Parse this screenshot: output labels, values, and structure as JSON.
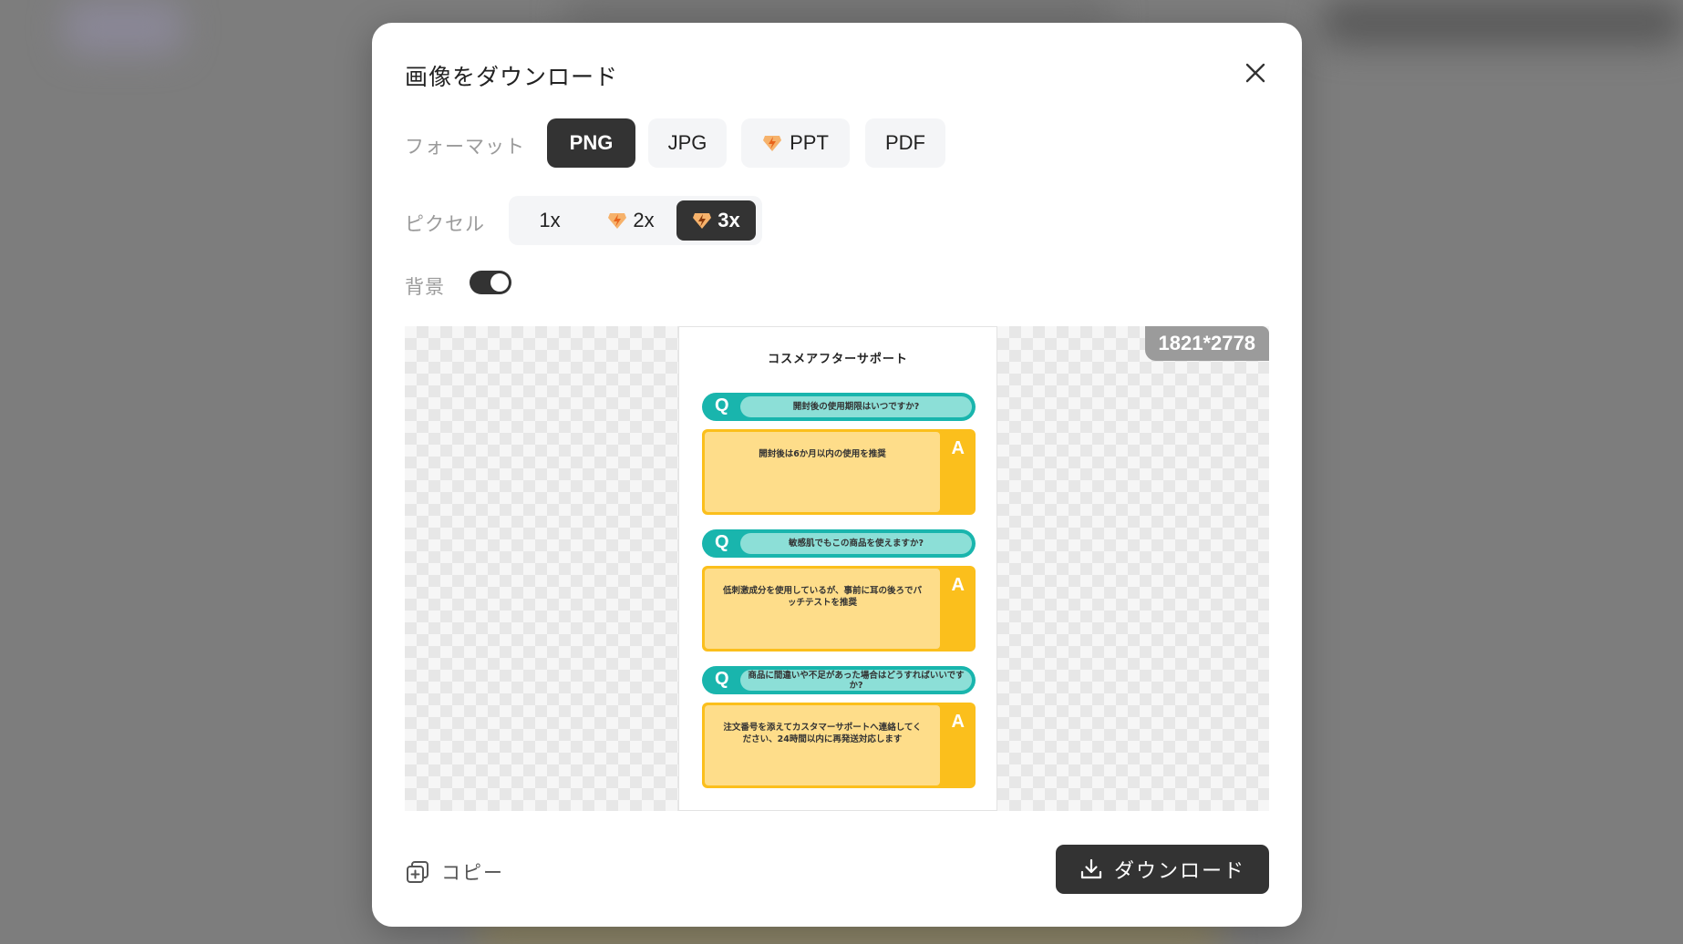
{
  "dialog": {
    "title": "画像をダウンロード"
  },
  "format": {
    "label": "フォーマット",
    "options": [
      {
        "label": "PNG",
        "selected": true,
        "premium": false
      },
      {
        "label": "JPG",
        "selected": false,
        "premium": false
      },
      {
        "label": "PPT",
        "selected": false,
        "premium": true
      },
      {
        "label": "PDF",
        "selected": false,
        "premium": false
      }
    ]
  },
  "pixel": {
    "label": "ピクセル",
    "options": [
      {
        "label": "1x",
        "selected": false,
        "premium": false
      },
      {
        "label": "2x",
        "selected": false,
        "premium": true
      },
      {
        "label": "3x",
        "selected": true,
        "premium": true
      }
    ]
  },
  "background": {
    "label": "背景",
    "enabled": true
  },
  "preview": {
    "dimensions": "1821*2778",
    "page_title": "コスメアフターサポート",
    "q_letter": "Q",
    "a_letter": "A",
    "items": [
      {
        "question": "開封後の使用期限はいつですか?",
        "answer": "開封後は6か月以内の使用を推奨"
      },
      {
        "question": "敏感肌でもこの商品を使えますか?",
        "answer": "低刺激成分を使用しているが、事前に耳の後ろでパッチテストを推奨"
      },
      {
        "question": "商品に間違いや不足があった場合はどうすればいいですか?",
        "answer": "注文番号を添えてカスタマーサポートへ連絡してください、24時間以内に再発送対応します"
      }
    ]
  },
  "actions": {
    "copy_label": "コピー",
    "download_label": "ダウンロード"
  },
  "colors": {
    "accent_dark": "#333333",
    "teal": "#19b5ad",
    "teal_light": "#8cdfd7",
    "yellow": "#fbbf1c",
    "yellow_light": "#fedd8a",
    "premium_orange": "#f5a03a"
  },
  "icons": {
    "close": "close-icon",
    "premium": "premium-gem-icon",
    "copy": "copy-icon",
    "download": "download-icon"
  }
}
